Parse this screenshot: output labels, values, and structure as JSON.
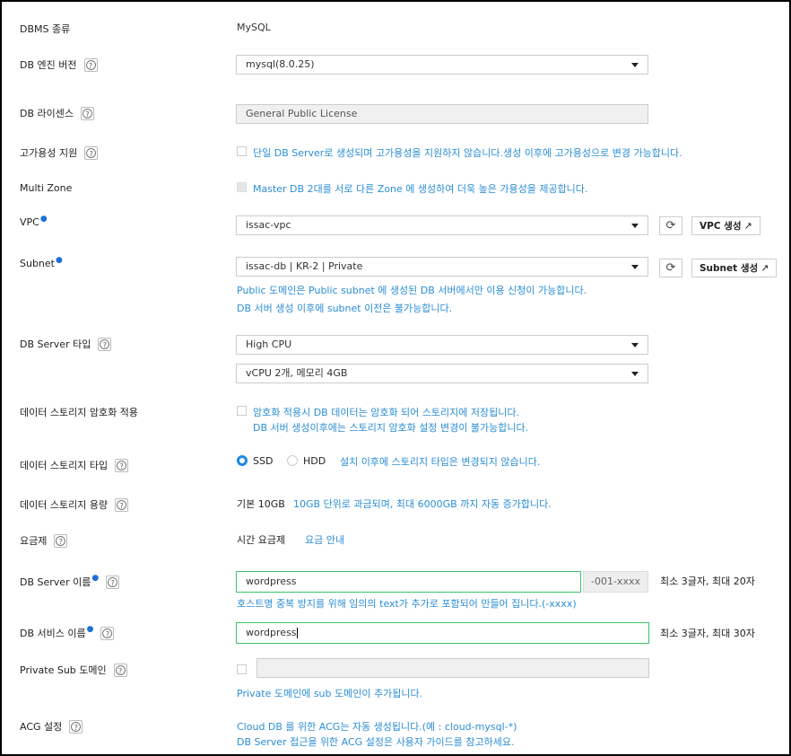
{
  "dbms": {
    "label": "DBMS 종류",
    "value": "MySQL"
  },
  "engine": {
    "label": "DB 엔진 버전",
    "value": "mysql(8.0.25)"
  },
  "license": {
    "label": "DB 라이센스",
    "value": "General Public License"
  },
  "ha": {
    "label": "고가용성 지원",
    "note": "단일 DB Server로 생성되며 고가용성을 지원하지 않습니다.생성 이후에 고가용성으로 변경 가능합니다."
  },
  "multizone": {
    "label": "Multi Zone",
    "note": "Master DB 2대를 서로 다른 Zone 에 생성하여 더욱 높은 가용성을 제공합니다."
  },
  "vpc": {
    "label": "VPC",
    "value": "issac-vpc",
    "create_label": "VPC 생성"
  },
  "subnet": {
    "label": "Subnet",
    "value": "issac-db | KR-2 | Private",
    "create_label": "Subnet 생성",
    "note1": "Public 도메인은 Public subnet 에 생성된 DB 서버에서만 이용 신청이 가능합니다.",
    "note2": "DB 서버 생성 이후에 subnet 이전은 불가능합니다."
  },
  "server_type": {
    "label": "DB Server 타입",
    "type_value": "High CPU",
    "spec_value": "vCPU 2개, 메모리 4GB"
  },
  "encryption": {
    "label": "데이터 스토리지 암호화 적용",
    "note1": "암호화 적용시 DB 데이터는 암호화 되어 스토리지에 저장됩니다.",
    "note2": "DB 서버 생성이후에는 스토리지 암호화 설정 변경이 불가능합니다."
  },
  "storage_type": {
    "label": "데이터 스토리지 타입",
    "ssd": "SSD",
    "hdd": "HDD",
    "note": "설치 이후에 스토리지 타입은 변경되지 않습니다."
  },
  "storage_size": {
    "label": "데이터 스토리지 용량",
    "value": "기본 10GB",
    "note": "10GB 단위로 과금되며, 최대 6000GB 까지 자동 증가합니다."
  },
  "pricing": {
    "label": "요금제",
    "value": "시간 요금제",
    "link": "요금 안내"
  },
  "server_name": {
    "label": "DB Server 이름",
    "value": "wordpress",
    "suffix": "-001-xxxx",
    "limit": "최소 3글자, 최대 20자",
    "note": "호스트명 중복 방지를 위해 임의의 text가 추가로 포함되어 만들어 집니다.(-xxxx)"
  },
  "service_name": {
    "label": "DB 서비스 이름",
    "value": "wordpress",
    "limit": "최소 3글자, 최대 30자"
  },
  "private_sub": {
    "label": "Private Sub 도메인",
    "note": "Private 도메인에 sub 도메인이 추가됩니다."
  },
  "acg": {
    "label": "ACG 설정",
    "note1": "Cloud DB 를 위한 ACG는 자동 생성됩니다.(예 : cloud-mysql-*)",
    "note2": "DB Server 접근을 위한 ACG 설정은 사용자 가이드를 참고하세요."
  },
  "colors": {
    "accent": "#2b8ed3",
    "required_dot": "#1e6fd9",
    "valid_border": "#3ac26a",
    "radio_on": "#1e88e5"
  },
  "icons": {
    "help": "help-icon",
    "refresh": "refresh-icon",
    "external": "external-link-icon",
    "dropdown": "chevron-down-icon"
  }
}
